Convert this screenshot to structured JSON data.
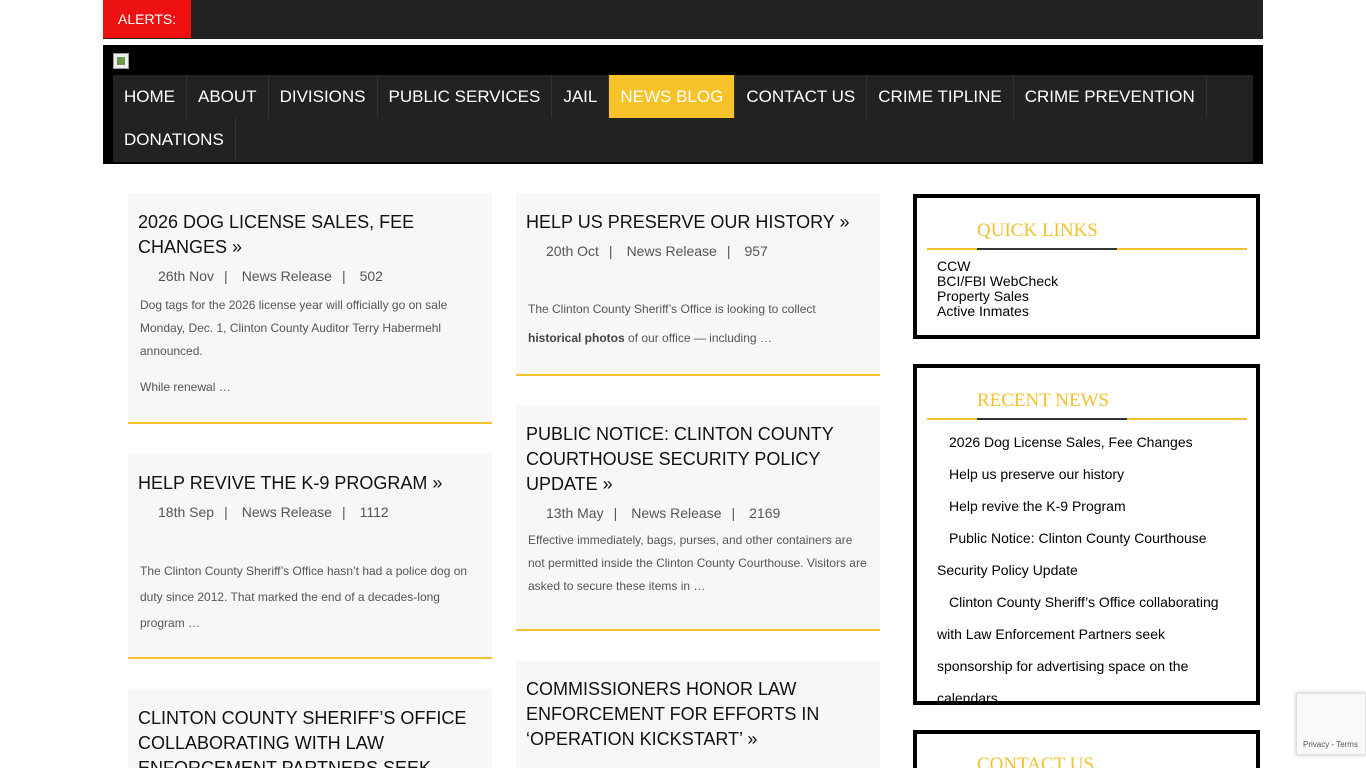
{
  "alerts": {
    "label": "ALERTS:"
  },
  "nav": {
    "items": [
      {
        "label": "HOME"
      },
      {
        "label": "ABOUT"
      },
      {
        "label": "DIVISIONS"
      },
      {
        "label": "PUBLIC SERVICES"
      },
      {
        "label": "JAIL"
      },
      {
        "label": "NEWS BLOG",
        "active": true
      },
      {
        "label": "CONTACT US"
      },
      {
        "label": "CRIME TIPLINE"
      },
      {
        "label": "CRIME PREVENTION"
      },
      {
        "label": "DONATIONS"
      }
    ],
    "accent_color": "#f7c22a"
  },
  "posts": [
    {
      "title": "2026 DOG LICENSE SALES, FEE CHANGES »",
      "date": "26th Nov",
      "category": "News Release",
      "views": "502",
      "excerpt_1": "Dog tags for the 2026 license year will officially go on sale Monday, Dec. 1, Clinton County Auditor Terry Habermehl announced.",
      "excerpt_2": "While renewal …"
    },
    {
      "title": "HELP US PRESERVE OUR HISTORY »",
      "date": "20th Oct",
      "category": "News Release",
      "views": "957",
      "excerpt_1": "The Clinton County Sheriff’s Office is looking to collect",
      "excerpt_bold": "historical photos",
      "excerpt_2": "of our office — including …"
    },
    {
      "title": "HELP REVIVE THE K-9 PROGRAM »",
      "date": "18th Sep",
      "category": "News Release",
      "views": "1112",
      "excerpt_1": "The Clinton County Sheriff’s Office hasn’t had a police dog on duty since 2012. That marked the end of a decades-long program …"
    },
    {
      "title": "PUBLIC NOTICE: CLINTON COUNTY COURTHOUSE SECURITY POLICY UPDATE »",
      "date": "13th May",
      "category": "News Release",
      "views": "2169",
      "excerpt_1": "Effective immediately, bags, purses, and other containers are not permitted inside the Clinton County Courthouse. Visitors are asked to secure these items in …"
    },
    {
      "title": "CLINTON COUNTY SHERIFF’S OFFICE COLLABORATING WITH LAW ENFORCEMENT PARTNERS SEEK"
    },
    {
      "title": "COMMISSIONERS HONOR LAW ENFORCEMENT FOR EFFORTS IN ‘OPERATION KICKSTART’ »"
    }
  ],
  "sidebar": {
    "quick_links": {
      "title": "QUICK LINKS",
      "items": [
        "CCW",
        "BCI/FBI WebCheck",
        "Property Sales",
        "Active Inmates"
      ]
    },
    "recent_news": {
      "title": "RECENT NEWS",
      "items": [
        "2026 Dog License Sales, Fee Changes",
        "Help us preserve our history",
        "Help revive the K-9 Program",
        "Public Notice: Clinton County Courthouse Security Policy Update",
        "Clinton County Sheriff’s Office collaborating with Law Enforcement Partners seek sponsorship for advertising space on the calendars"
      ]
    },
    "contact": {
      "title": "CONTACT US"
    }
  },
  "recaptcha": {
    "links": "Privacy - Terms"
  }
}
